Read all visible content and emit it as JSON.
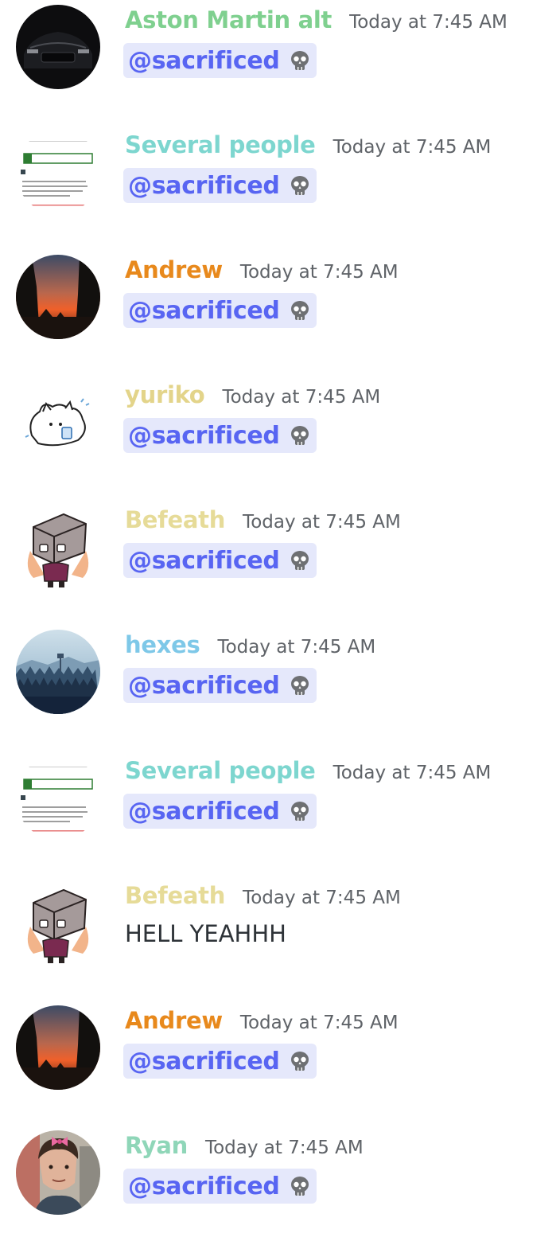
{
  "colors": {
    "mention_bg": "#e5e8fb",
    "mention_text": "#5865f2",
    "timestamp": "#5f6368"
  },
  "messages": [
    {
      "author": "Aston Martin alt",
      "color": "#7fd08f",
      "time": "Today at 7:45 AM",
      "mention": "@sacrificed",
      "emoji": "skull-icon",
      "avatar": "car"
    },
    {
      "author": "Several people",
      "color": "#7dd6cf",
      "time": "Today at 7:45 AM",
      "mention": "@sacrificed",
      "emoji": "skull-icon",
      "avatar": "worksheet"
    },
    {
      "author": "Andrew",
      "color": "#e8891c",
      "time": "Today at 7:45 AM",
      "mention": "@sacrificed",
      "emoji": "skull-icon",
      "avatar": "sunset"
    },
    {
      "author": "yuriko",
      "color": "#e3d48a",
      "time": "Today at 7:45 AM",
      "mention": "@sacrificed",
      "emoji": "skull-icon",
      "avatar": "cat"
    },
    {
      "author": "Befeath",
      "color": "#e6db98",
      "time": "Today at 7:45 AM",
      "mention": "@sacrificed",
      "emoji": "skull-icon",
      "avatar": "boxhead"
    },
    {
      "author": "hexes",
      "color": "#7ec8e8",
      "time": "Today at 7:45 AM",
      "mention": "@sacrificed",
      "emoji": "skull-icon",
      "avatar": "forest"
    },
    {
      "author": "Several people",
      "color": "#7dd6cf",
      "time": "Today at 7:45 AM",
      "mention": "@sacrificed",
      "emoji": "skull-icon",
      "avatar": "worksheet"
    },
    {
      "author": "Befeath",
      "color": "#e6db98",
      "time": "Today at 7:45 AM",
      "text": "HELL YEAHHH",
      "avatar": "boxhead"
    },
    {
      "author": "Andrew",
      "color": "#e8891c",
      "time": "Today at 7:45 AM",
      "mention": "@sacrificed",
      "emoji": "skull-icon",
      "avatar": "sunset"
    },
    {
      "author": "Ryan",
      "color": "#8fd6b8",
      "time": "Today at 7:45 AM",
      "mention": "@sacrificed",
      "emoji": "skull-icon",
      "avatar": "person"
    }
  ]
}
